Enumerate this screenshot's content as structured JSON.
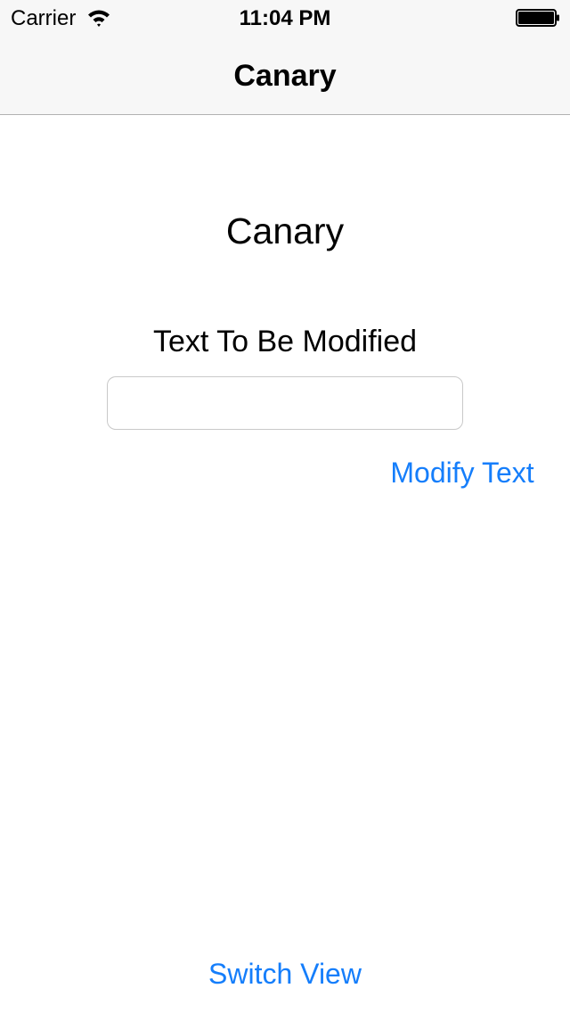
{
  "status_bar": {
    "carrier": "Carrier",
    "time": "11:04 PM",
    "wifi_icon": "wifi-icon",
    "battery_icon": "battery-full-icon"
  },
  "nav": {
    "title": "Canary"
  },
  "main": {
    "heading": "Canary",
    "field_label": "Text To Be Modified",
    "text_field_value": "",
    "modify_button_label": "Modify Text",
    "switch_button_label": "Switch View"
  },
  "colors": {
    "accent": "#157efb",
    "nav_background": "#f7f7f7",
    "nav_border": "#b2b2b2"
  }
}
